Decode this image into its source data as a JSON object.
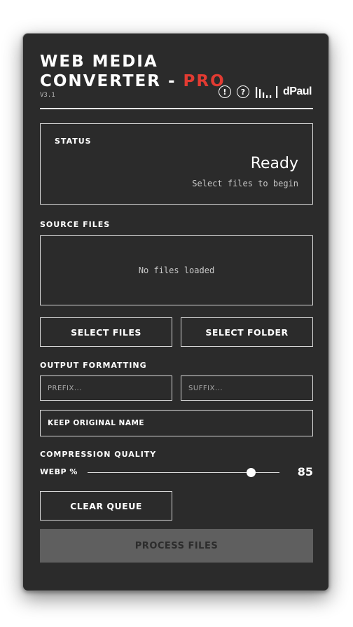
{
  "app": {
    "title_line1": "WEB MEDIA",
    "title_line2": "CONVERTER - ",
    "title_pro": "PRO",
    "version": "V3.1"
  },
  "header": {
    "info_icon": "!",
    "help_icon": "?",
    "logo_text": "dPaul"
  },
  "status": {
    "label": "STATUS",
    "value": "Ready",
    "hint": "Select files to begin"
  },
  "source_files": {
    "label": "SOURCE FILES",
    "empty_text": "No files loaded",
    "select_files_label": "SELECT FILES",
    "select_folder_label": "SELECT FOLDER"
  },
  "output": {
    "label": "OUTPUT FORMATTING",
    "prefix_placeholder": "PREFIX...",
    "suffix_placeholder": "SUFFIX...",
    "prefix_value": "",
    "suffix_value": "",
    "keep_name_label": "KEEP ORIGINAL NAME"
  },
  "compression": {
    "label": "COMPRESSION QUALITY",
    "slider_label": "WEBP %",
    "value": "85",
    "min": 0,
    "max": 100
  },
  "actions": {
    "clear_queue_label": "CLEAR QUEUE",
    "process_label": "PROCESS FILES"
  },
  "colors": {
    "background": "#2b2b2b",
    "accent": "#e23b32",
    "disabled_button": "#5f5f5f"
  }
}
